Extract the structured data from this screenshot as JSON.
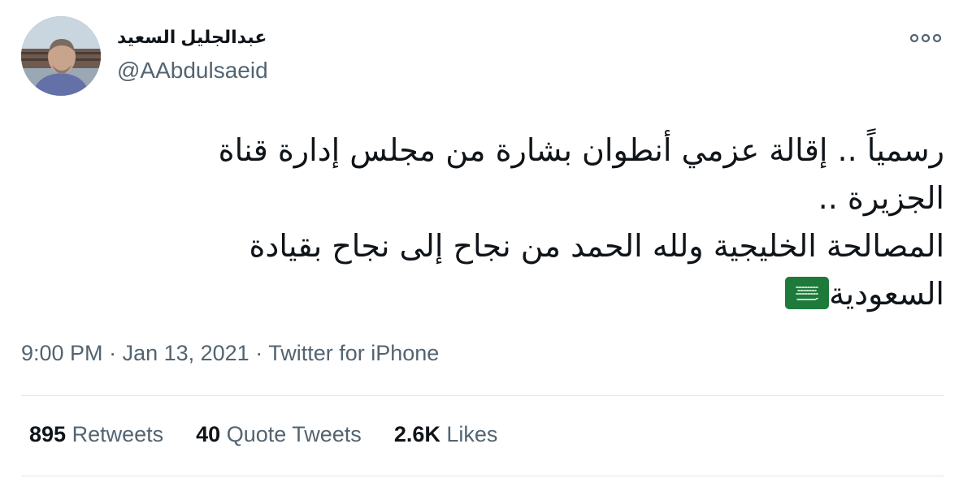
{
  "author": {
    "display_name": "عبدالجليل السعيد",
    "handle": "@AAbdulsaeid"
  },
  "tweet": {
    "lines": [
      "رسمياً .. إقالة عزمي أنطوان بشارة من مجلس إدارة قناة",
      "الجزيرة ..",
      "المصالحة الخليجية ولله الحمد من نجاح إلى نجاح بقيادة",
      "السعودية"
    ],
    "emoji": "saudi-arabia-flag"
  },
  "meta": {
    "time": "9:00 PM",
    "separator1": " · ",
    "date": "Jan 13, 2021",
    "separator2": " · ",
    "source": "Twitter for iPhone"
  },
  "stats": {
    "retweets_count": "895",
    "retweets_label": "Retweets",
    "quotes_count": "40",
    "quotes_label": "Quote Tweets",
    "likes_count": "2.6K",
    "likes_label": "Likes"
  },
  "colors": {
    "text": "#0f1419",
    "secondary": "#536471",
    "divider": "#e1e6ea",
    "flag_green": "#1e7a3b"
  }
}
